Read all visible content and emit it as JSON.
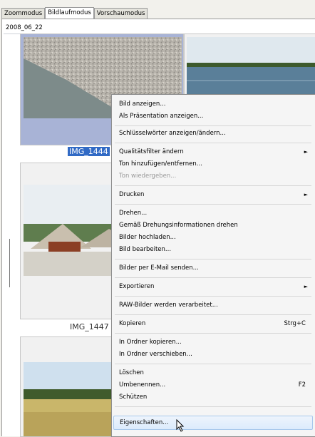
{
  "tabs": [
    {
      "label": "Zoommodus",
      "active": false
    },
    {
      "label": "Bildlaufmodus",
      "active": true
    },
    {
      "label": "Vorschaumodus",
      "active": false
    }
  ],
  "folder_label": "2008_06_22",
  "thumbnails": [
    {
      "caption": "IMG_1444",
      "selected": true
    },
    {
      "caption": "IMG_1447",
      "selected": false
    }
  ],
  "context_menu": {
    "items": [
      {
        "label": "Bild anzeigen..."
      },
      {
        "label": "Als Präsentation anzeigen..."
      },
      {
        "label": "Schlüsselwörter anzeigen/ändern..."
      },
      {
        "label": "Qualitätsfilter ändern",
        "submenu": true
      },
      {
        "label": "Ton hinzufügen/entfernen..."
      },
      {
        "label": "Ton wiedergeben...",
        "disabled": true
      },
      {
        "label": "Drucken",
        "submenu": true
      },
      {
        "label": "Drehen..."
      },
      {
        "label": "Gemäß Drehungsinformationen drehen"
      },
      {
        "label": "Bilder hochladen..."
      },
      {
        "label": "Bild bearbeiten..."
      },
      {
        "label": "Bilder per E-Mail senden..."
      },
      {
        "label": "Exportieren",
        "submenu": true
      },
      {
        "label": "RAW-Bilder werden verarbeitet..."
      },
      {
        "label": "Kopieren",
        "shortcut": "Strg+C"
      },
      {
        "label": "In Ordner kopieren..."
      },
      {
        "label": "In Ordner verschieben..."
      },
      {
        "label": "Löschen"
      },
      {
        "label": "Umbenennen...",
        "shortcut": "F2"
      },
      {
        "label": "Schützen"
      },
      {
        "label": "Eigenschaften...",
        "highlighted": true
      }
    ]
  },
  "icons": {
    "submenu_arrow": "submenu-arrow-icon",
    "cursor": "mouse-pointer-icon"
  }
}
